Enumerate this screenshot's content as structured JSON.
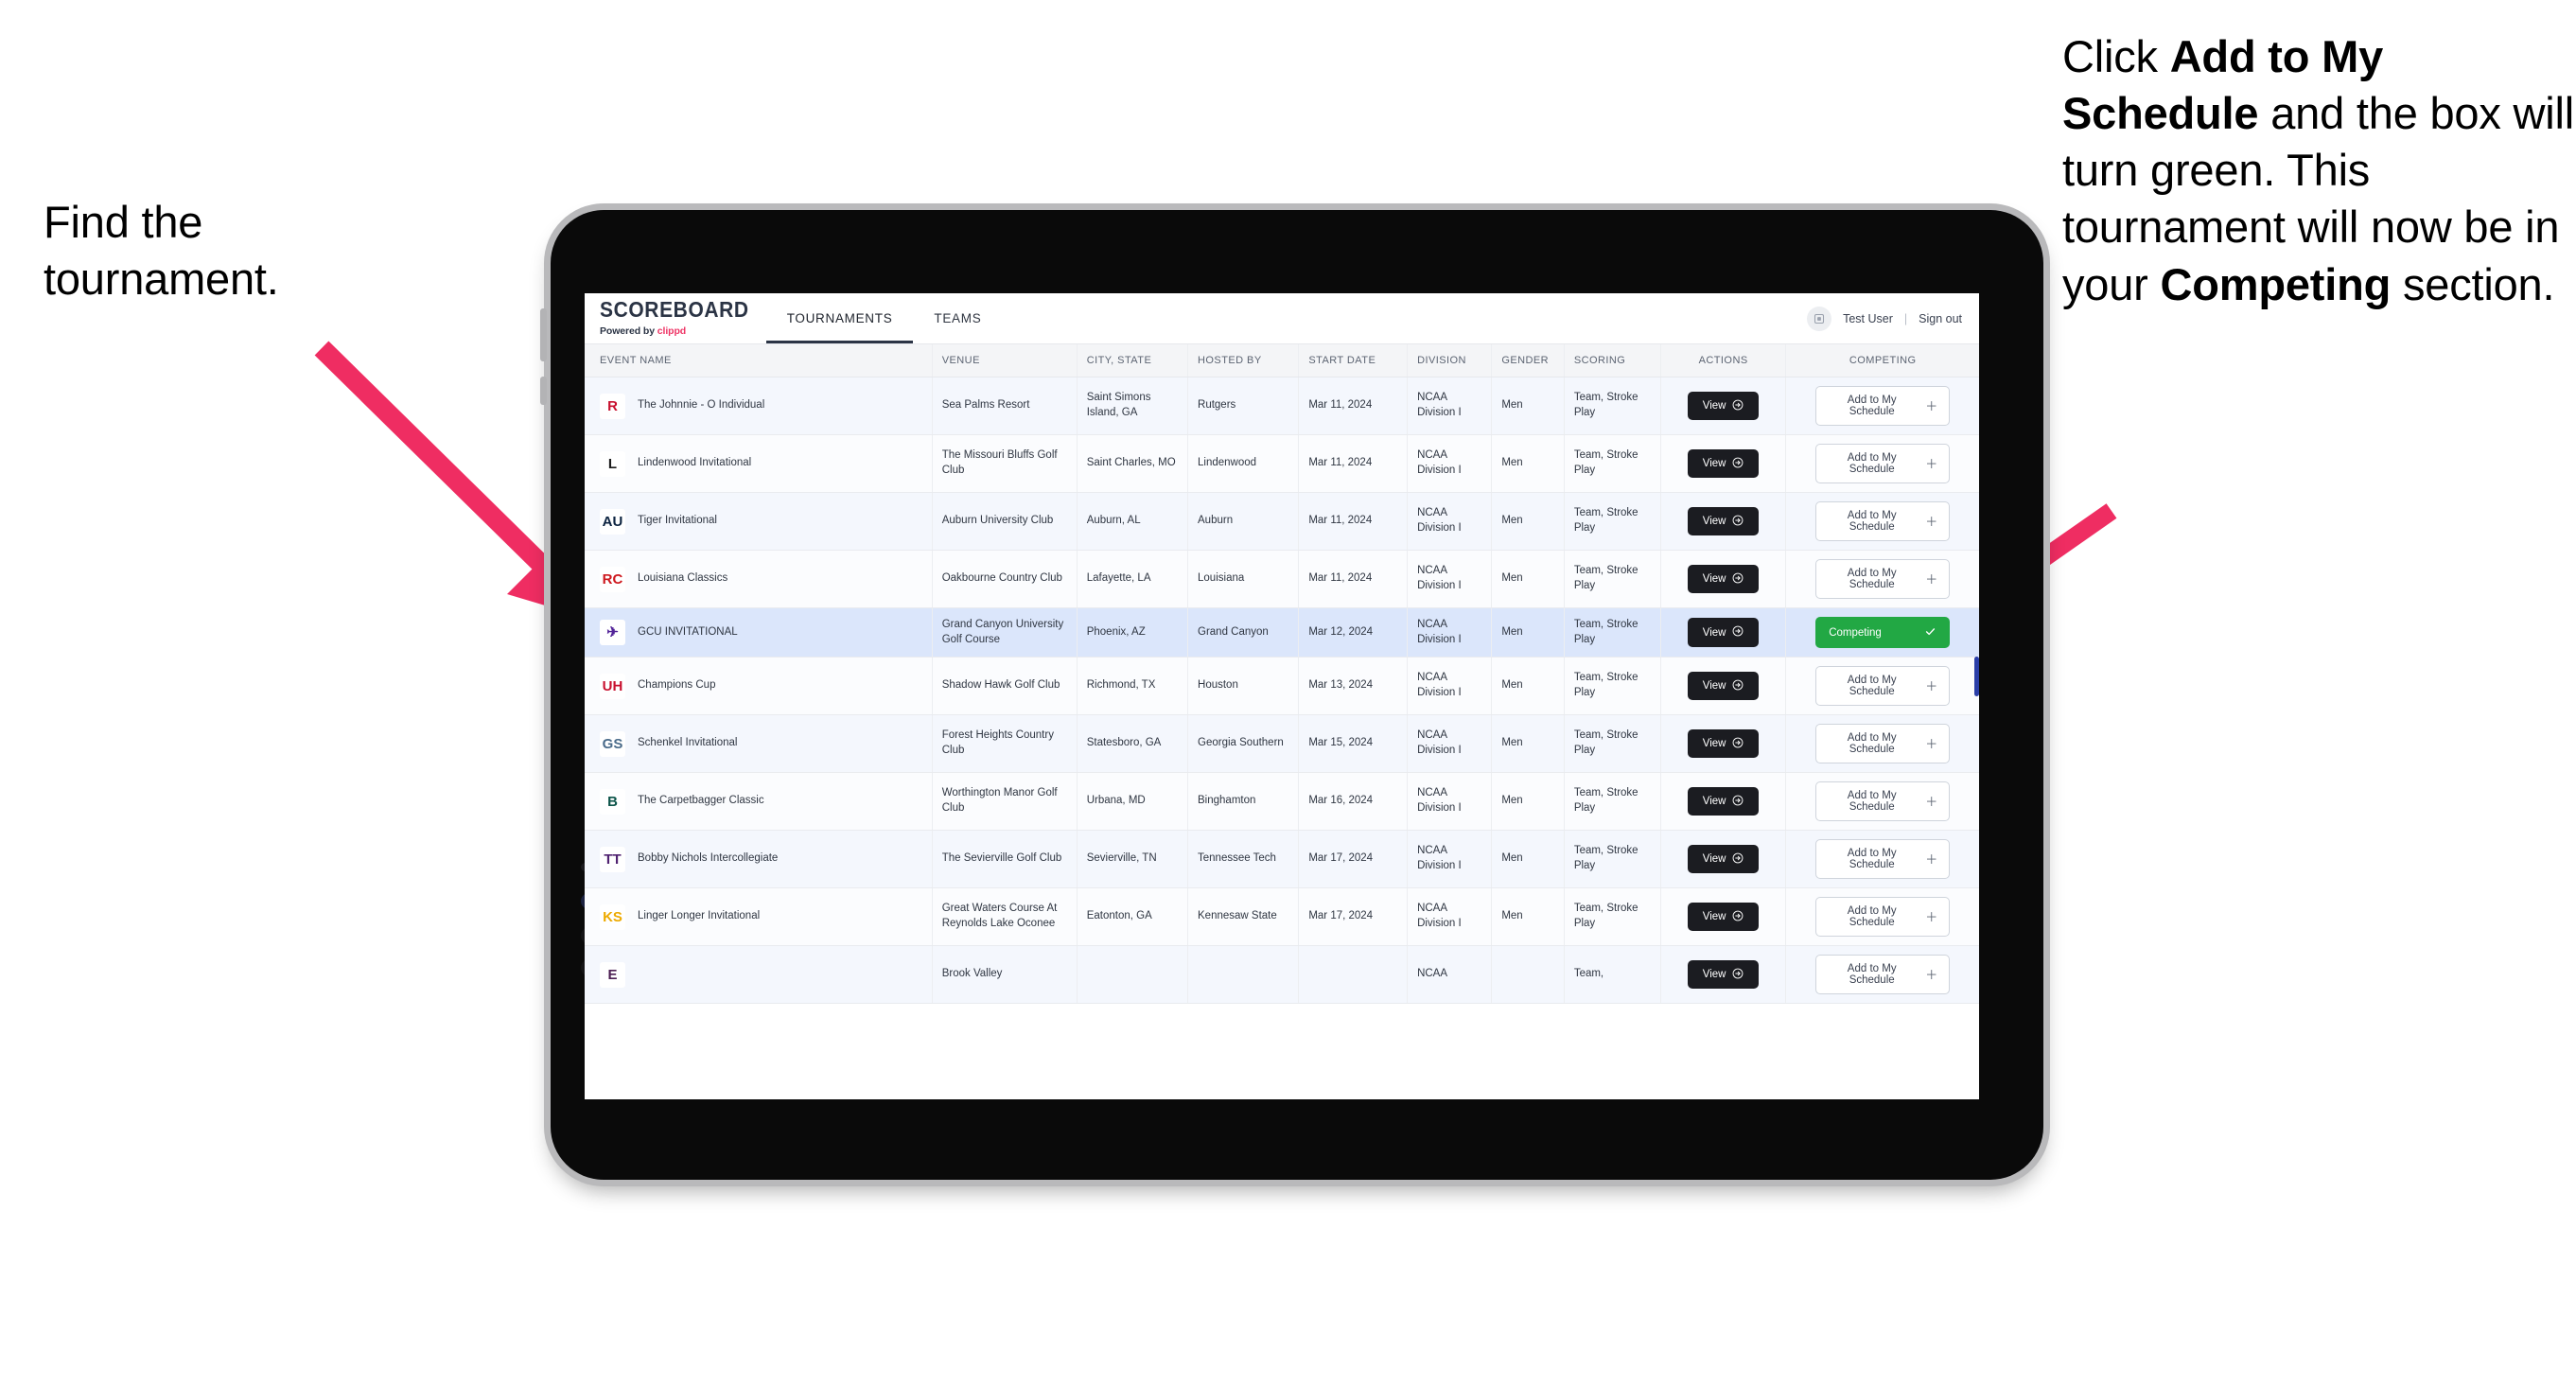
{
  "annotations": {
    "left": {
      "line1": "Find the",
      "line2": "tournament."
    },
    "right": {
      "seg1": "Click ",
      "bold1": "Add to My Schedule",
      "seg2": " and the box will turn green. This tournament will now be in your ",
      "bold2": "Competing",
      "seg3": " section."
    },
    "arrow_color": "#ef2d62"
  },
  "app": {
    "brand": {
      "title": "SCOREBOARD",
      "powered_prefix": "Powered by ",
      "powered_name": "clippd"
    },
    "tabs": [
      {
        "label": "TOURNAMENTS",
        "active": true
      },
      {
        "label": "TEAMS",
        "active": false
      }
    ],
    "header_right": {
      "avatar_icon": "user-avatar-icon",
      "user": "Test User",
      "separator": "|",
      "sign_out": "Sign out"
    }
  },
  "table": {
    "columns": [
      "EVENT NAME",
      "VENUE",
      "CITY, STATE",
      "HOSTED BY",
      "START DATE",
      "DIVISION",
      "GENDER",
      "SCORING",
      "ACTIONS",
      "COMPETING"
    ],
    "view_label": "View",
    "view_icon": "arrow-circle-right-icon",
    "add_label": "Add to My Schedule",
    "add_icon": "plus-icon",
    "competing_label": "Competing",
    "competing_icon": "check-icon",
    "competing_color": "#22a844",
    "rows": [
      {
        "logo_text": "R",
        "logo_bg": "#ffffff",
        "logo_fg": "#c8102e",
        "event": "The Johnnie - O Individual",
        "venue": "Sea Palms Resort",
        "city": "Saint Simons Island, GA",
        "host": "Rutgers",
        "date": "Mar 11, 2024",
        "division": "NCAA Division I",
        "gender": "Men",
        "scoring": "Team, Stroke Play",
        "competing": false
      },
      {
        "logo_text": "L",
        "logo_bg": "#ffffff",
        "logo_fg": "#1b1b1b",
        "event": "Lindenwood Invitational",
        "venue": "The Missouri Bluffs Golf Club",
        "city": "Saint Charles, MO",
        "host": "Lindenwood",
        "date": "Mar 11, 2024",
        "division": "NCAA Division I",
        "gender": "Men",
        "scoring": "Team, Stroke Play",
        "competing": false
      },
      {
        "logo_text": "AU",
        "logo_bg": "#ffffff",
        "logo_fg": "#0c2340",
        "event": "Tiger Invitational",
        "venue": "Auburn University Club",
        "city": "Auburn, AL",
        "host": "Auburn",
        "date": "Mar 11, 2024",
        "division": "NCAA Division I",
        "gender": "Men",
        "scoring": "Team, Stroke Play",
        "competing": false
      },
      {
        "logo_text": "RC",
        "logo_bg": "#ffffff",
        "logo_fg": "#ce181e",
        "event": "Louisiana Classics",
        "venue": "Oakbourne Country Club",
        "city": "Lafayette, LA",
        "host": "Louisiana",
        "date": "Mar 11, 2024",
        "division": "NCAA Division I",
        "gender": "Men",
        "scoring": "Team, Stroke Play",
        "competing": false
      },
      {
        "logo_text": "✈",
        "logo_bg": "#ffffff",
        "logo_fg": "#522398",
        "event": "GCU INVITATIONAL",
        "venue": "Grand Canyon University Golf Course",
        "city": "Phoenix, AZ",
        "host": "Grand Canyon",
        "date": "Mar 12, 2024",
        "division": "NCAA Division I",
        "gender": "Men",
        "scoring": "Team, Stroke Play",
        "competing": true,
        "selected": true
      },
      {
        "logo_text": "UH",
        "logo_bg": "#ffffff",
        "logo_fg": "#c8102e",
        "event": "Champions Cup",
        "venue": "Shadow Hawk Golf Club",
        "city": "Richmond, TX",
        "host": "Houston",
        "date": "Mar 13, 2024",
        "division": "NCAA Division I",
        "gender": "Men",
        "scoring": "Team, Stroke Play",
        "competing": false
      },
      {
        "logo_text": "GS",
        "logo_bg": "#ffffff",
        "logo_fg": "#4a6b8a",
        "event": "Schenkel Invitational",
        "venue": "Forest Heights Country Club",
        "city": "Statesboro, GA",
        "host": "Georgia Southern",
        "date": "Mar 15, 2024",
        "division": "NCAA Division I",
        "gender": "Men",
        "scoring": "Team, Stroke Play",
        "competing": false
      },
      {
        "logo_text": "B",
        "logo_bg": "#ffffff",
        "logo_fg": "#0c5449",
        "event": "The Carpetbagger Classic",
        "venue": "Worthington Manor Golf Club",
        "city": "Urbana, MD",
        "host": "Binghamton",
        "date": "Mar 16, 2024",
        "division": "NCAA Division I",
        "gender": "Men",
        "scoring": "Team, Stroke Play",
        "competing": false
      },
      {
        "logo_text": "TT",
        "logo_bg": "#ffffff",
        "logo_fg": "#4f2170",
        "event": "Bobby Nichols Intercollegiate",
        "venue": "The Sevierville Golf Club",
        "city": "Sevierville, TN",
        "host": "Tennessee Tech",
        "date": "Mar 17, 2024",
        "division": "NCAA Division I",
        "gender": "Men",
        "scoring": "Team, Stroke Play",
        "competing": false
      },
      {
        "logo_text": "KS",
        "logo_bg": "#ffffff",
        "logo_fg": "#edaa00",
        "event": "Linger Longer Invitational",
        "venue": "Great Waters Course At Reynolds Lake Oconee",
        "city": "Eatonton, GA",
        "host": "Kennesaw State",
        "date": "Mar 17, 2024",
        "division": "NCAA Division I",
        "gender": "Men",
        "scoring": "Team, Stroke Play",
        "competing": false
      },
      {
        "logo_text": "E",
        "logo_bg": "#ffffff",
        "logo_fg": "#4b1e52",
        "event": "",
        "venue": "Brook Valley",
        "city": "",
        "host": "",
        "date": "",
        "division": "NCAA",
        "gender": "",
        "scoring": "Team,",
        "competing": false,
        "partial": true
      }
    ]
  }
}
